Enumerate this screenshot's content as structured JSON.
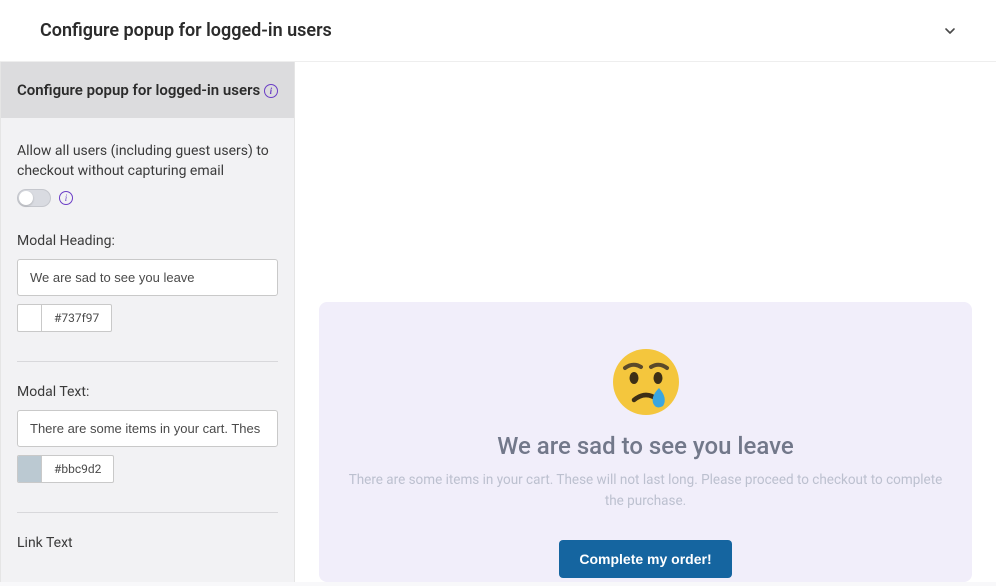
{
  "topbar": {
    "title": "Configure popup for logged-in users"
  },
  "sidebar": {
    "header": "Configure popup for logged-in users",
    "allow_all_label": "Allow all users (including guest users) to checkout without capturing email",
    "modal_heading": {
      "label": "Modal Heading:",
      "value": "We are sad to see you leave",
      "color": "#737f97"
    },
    "modal_text": {
      "label": "Modal Text:",
      "value": "There are some items in your cart. Thes",
      "color": "#bbc9d2"
    },
    "link_text_label": "Link Text"
  },
  "preview": {
    "heading": "We are sad to see you leave",
    "text": "There are some items in your cart. These will not last long. Please proceed to checkout to complete the purchase.",
    "button": "Complete my order!"
  }
}
